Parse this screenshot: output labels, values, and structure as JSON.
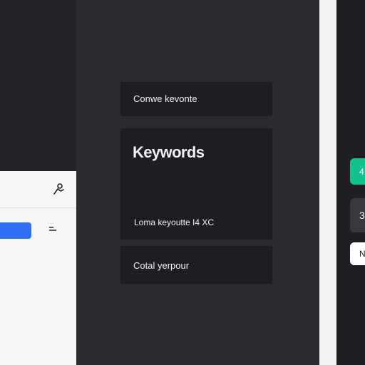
{
  "cards": {
    "top_label": "Conwe kevonte",
    "main_title": "Keywords",
    "main_sub": "Loma keyoutte I4 XC",
    "bottom_label": "Cotal yerpour"
  },
  "right_rail": {
    "pill_green": "4",
    "pill_dark": "3",
    "pill_white": "N"
  },
  "icons": {
    "left_card_top": "person-icon",
    "left_card_menu": "menu-icon"
  },
  "colors": {
    "accent_blue": "#2f6ff2",
    "accent_green": "#13c28d",
    "background": "#28272b",
    "card": "#1e1d21"
  }
}
